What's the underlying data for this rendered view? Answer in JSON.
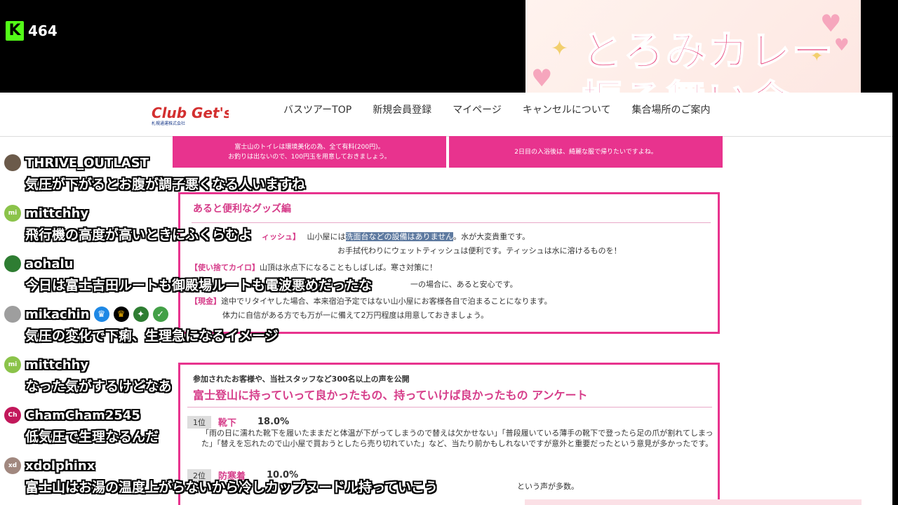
{
  "stream": {
    "viewer_count": "464",
    "kick_logo_letter": "K"
  },
  "banner": {
    "line1": "とろみカレー",
    "line2": "振る舞い会"
  },
  "site": {
    "nav": [
      "バスツアーTOP",
      "新規会員登録",
      "マイページ",
      "キャンセルについて",
      "集合場所のご案内"
    ],
    "logo_text": "Club Get's",
    "logo_sub": "札幌通運株式会社",
    "pink_box_left": [
      "富士山のトイレは環境美化の為、全て有料(200円)。",
      "お釣りは出ないので、100円玉を用意しておきましょう。"
    ],
    "pink_box_right": "2日目の入浴後は、綺麗な服で帰りたいですよね。",
    "goods": {
      "title": "あると便利なグッズ編",
      "item1_tag": "ィッシュ】",
      "item1_pre": "山小屋には",
      "item1_hl": "洗面台などの設備はありません",
      "item1_post": "。水が大変貴重です。",
      "item1_line2": "お手拭代わりにウェットティッシュは便利です。ティッシュは水に溶けるものを！",
      "item2_tag": "【使い捨てカイロ】",
      "item2_text": "山頂は氷点下になることもしばしば。寒さ対策に！",
      "item3_text": "一の場合に、あると安心です。",
      "item4_tag": "【現金】",
      "item4_text": "途中でリタイヤした場合、本来宿泊予定ではない山小屋にお客様各自で泊まることになります。",
      "item4_line2": "体力に自信がある方でも万が一に備えて2万円程度は用意しておきましょう。"
    },
    "survey": {
      "intro": "参加されたお客様や、当社スタッフなど300名以上の声を公開",
      "title": "富士登山に持っていって良かったもの、持っていけば良かったもの アンケート",
      "rank1": {
        "rank": "1位",
        "name": "靴下",
        "percent": "18.0%"
      },
      "rank1_text": "「雨の日に濡れた靴下を履いたままだと体温が下がってしまうので替えは欠かせない」「普段履いている薄手の靴下で登ったら足の爪が割れてしまった」「替えを忘れたので山小屋で買おうとしたら売り切れていた」など、当たり前かもしれないですが意外と重要だったという意見が多かったです。",
      "rank2": {
        "rank": "2位",
        "name": "防寒着",
        "percent": "10.0%"
      },
      "rank2_text": "という声が多数。"
    }
  },
  "chat": [
    {
      "user": "THRIVE_OUTLAST",
      "avatar": "",
      "avatar_color": "#6b5a4a",
      "text": "気圧が下がるとお腹が調子悪くなる人いますね",
      "badges": []
    },
    {
      "user": "mittchhy",
      "avatar": "mi",
      "avatar_color": "#8bc34a",
      "text": "飛行機の高度が高いときにふくらむよ",
      "badges": []
    },
    {
      "user": "aohalu",
      "avatar": "",
      "avatar_color": "#2e7d32",
      "text": "今日は富士吉田ルートも御殿場ルートも電波悪めだったな",
      "badges": []
    },
    {
      "user": "mikachin",
      "avatar": "",
      "avatar_color": "#9e9e9e",
      "text": "気圧の変化で下痢、生理急になるイメージ",
      "badges": [
        "crown-icon",
        "crown-gold-icon",
        "star-icon",
        "check-icon"
      ]
    },
    {
      "user": "mittchhy",
      "avatar": "mi",
      "avatar_color": "#8bc34a",
      "text": "なった気がするけどなあ",
      "badges": []
    },
    {
      "user": "ChamCham2545",
      "avatar": "Ch",
      "avatar_color": "#c2185b",
      "text": "低気圧で生理なるんだ",
      "badges": []
    },
    {
      "user": "xdolphinx",
      "avatar": "xd",
      "avatar_color": "#a1887f",
      "text": "富士山はお湯の温度上がらないから冷しカップヌードル持っていこう",
      "badges": []
    }
  ]
}
